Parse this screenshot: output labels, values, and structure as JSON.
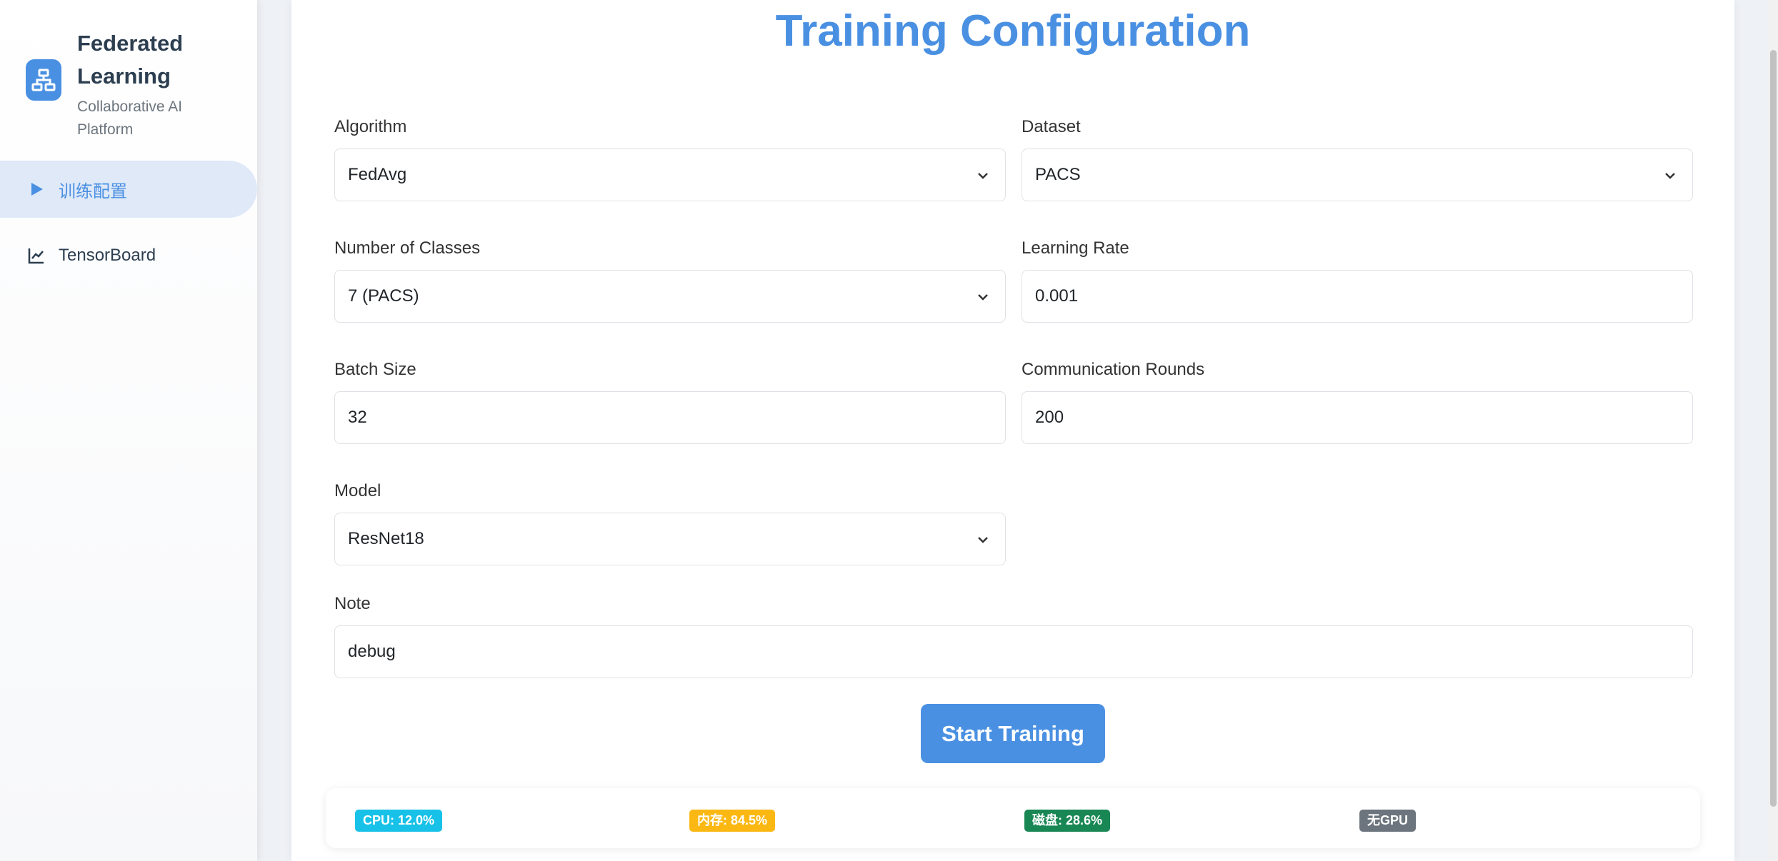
{
  "sidebar": {
    "brand_title": "Federated Learning",
    "brand_subtitle": "Collaborative AI Platform",
    "logo_icon": "network-icon",
    "items": [
      {
        "label": "训练配置",
        "icon": "play-icon",
        "active": true
      },
      {
        "label": "TensorBoard",
        "icon": "line-chart-icon",
        "active": false
      }
    ]
  },
  "main": {
    "title": "Training Configuration",
    "fields": {
      "algorithm": {
        "label": "Algorithm",
        "value": "FedAvg"
      },
      "dataset": {
        "label": "Dataset",
        "value": "PACS"
      },
      "num_classes": {
        "label": "Number of Classes",
        "value": "7 (PACS)"
      },
      "learning_rate": {
        "label": "Learning Rate",
        "value": "0.001"
      },
      "batch_size": {
        "label": "Batch Size",
        "value": "32"
      },
      "rounds": {
        "label": "Communication Rounds",
        "value": "200"
      },
      "model": {
        "label": "Model",
        "value": "ResNet18"
      },
      "note": {
        "label": "Note",
        "value": "debug"
      }
    },
    "start_button": "Start Training"
  },
  "status": {
    "cpu": {
      "text": "CPU: 12.0%",
      "color": "#17c1e8"
    },
    "memory": {
      "text": "内存: 84.5%",
      "color": "#fbb813"
    },
    "disk": {
      "text": "磁盘: 28.6%",
      "color": "#198754"
    },
    "gpu": {
      "text": "无GPU",
      "color": "#6c757d"
    }
  },
  "colors": {
    "accent": "#4a90e2"
  }
}
